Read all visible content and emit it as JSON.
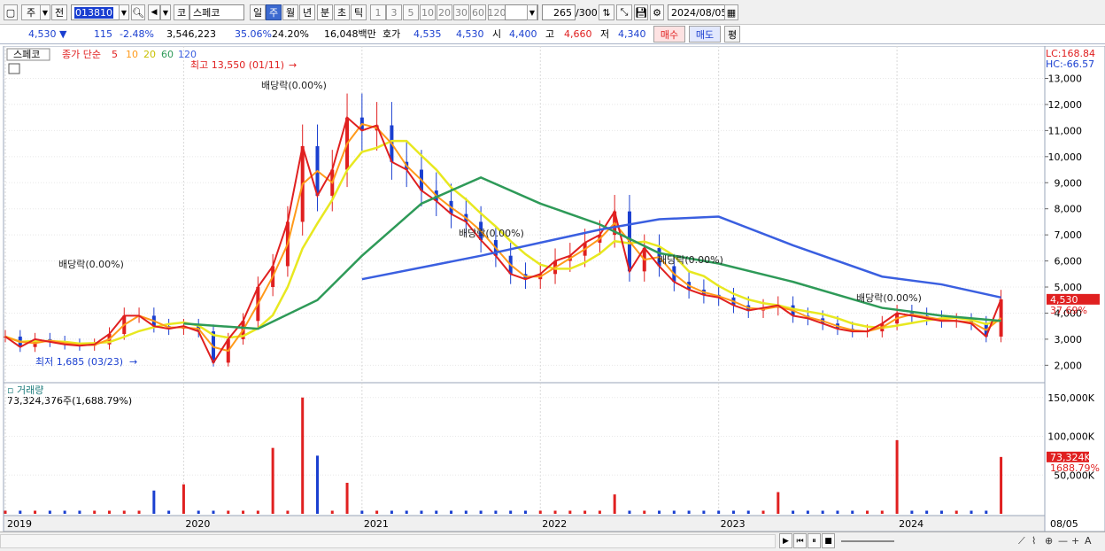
{
  "toolbar": {
    "market": "주",
    "prev_label": "전",
    "code": "013810",
    "market_code": "코",
    "name": "스페코",
    "periods": [
      "일",
      "주",
      "월",
      "년",
      "분",
      "초",
      "틱"
    ],
    "selected_period": "주",
    "intervals": [
      "1",
      "3",
      "5",
      "10",
      "20",
      "30",
      "60",
      "120"
    ],
    "count": "265",
    "count_total": "/300",
    "date": "2024/08/05"
  },
  "quote": {
    "price": "4,530",
    "change": "115",
    "change_pct": "-2.48%",
    "volume": "3,546,223",
    "volume_ratio": "35.06%",
    "turnover": "24.20%",
    "amount": "16,048백만",
    "bid_label": "호가",
    "bid": "4,535",
    "ask": "4,530",
    "open_label": "시",
    "open": "4,400",
    "high_label": "고",
    "high": "4,660",
    "low_label": "저",
    "low": "4,340",
    "buy_label": "매수",
    "sell_label": "매도",
    "eval_label": "평"
  },
  "chart_data": {
    "type": "candlestick",
    "name": "스페코",
    "legend": {
      "price": "종가 단순",
      "ma": [
        {
          "period": "5",
          "color": "#e02020"
        },
        {
          "period": "10",
          "color": "#ff9a1a"
        },
        {
          "period": "20",
          "color": "#e8e820"
        },
        {
          "period": "60",
          "color": "#2e9a58"
        },
        {
          "period": "120",
          "color": "#3a5fe0"
        }
      ]
    },
    "lc_label": "LC:168.84",
    "hc_label": "HC:-66.57",
    "price_axis": [
      "13,000",
      "12,000",
      "11,000",
      "10,000",
      "9,000",
      "8,000",
      "7,000",
      "6,000",
      "5,000",
      "4,000",
      "3,000",
      "2,000"
    ],
    "price_range": [
      1400,
      13900
    ],
    "current_price": "4,530",
    "current_pct": "37.69%",
    "high_annotation": "최고 13,550 (01/11)",
    "low_annotation": "최저 1,685 (03/23)",
    "dividend_label": "배당락(0.00%)",
    "close_series": [
      {
        "date": "2019-01",
        "close": 3100
      },
      {
        "date": "2019-02",
        "close": 2700
      },
      {
        "date": "2019-03",
        "close": 3000
      },
      {
        "date": "2019-04",
        "close": 2900
      },
      {
        "date": "2019-05",
        "close": 2800
      },
      {
        "date": "2019-06",
        "close": 2750
      },
      {
        "date": "2019-07",
        "close": 2800
      },
      {
        "date": "2019-08",
        "close": 3200
      },
      {
        "date": "2019-09",
        "close": 3900
      },
      {
        "date": "2019-10",
        "close": 3900
      },
      {
        "date": "2019-11",
        "close": 3500
      },
      {
        "date": "2019-12",
        "close": 3400
      },
      {
        "date": "2020-01",
        "close": 3500
      },
      {
        "date": "2020-02",
        "close": 3300
      },
      {
        "date": "2020-03",
        "close": 2100
      },
      {
        "date": "2020-04",
        "close": 3000
      },
      {
        "date": "2020-05",
        "close": 3700
      },
      {
        "date": "2020-06",
        "close": 5000
      },
      {
        "date": "2020-07",
        "close": 5800
      },
      {
        "date": "2020-08",
        "close": 7500
      },
      {
        "date": "2020-09",
        "close": 10400
      },
      {
        "date": "2020-10",
        "close": 8500
      },
      {
        "date": "2020-11",
        "close": 9500
      },
      {
        "date": "2020-12",
        "close": 11500
      },
      {
        "date": "2021-01",
        "close": 11000
      },
      {
        "date": "2021-02",
        "close": 11200
      },
      {
        "date": "2021-03",
        "close": 9800
      },
      {
        "date": "2021-04",
        "close": 9500
      },
      {
        "date": "2021-05",
        "close": 8700
      },
      {
        "date": "2021-06",
        "close": 8300
      },
      {
        "date": "2021-07",
        "close": 7800
      },
      {
        "date": "2021-08",
        "close": 7500
      },
      {
        "date": "2021-09",
        "close": 6800
      },
      {
        "date": "2021-10",
        "close": 6200
      },
      {
        "date": "2021-11",
        "close": 5500
      },
      {
        "date": "2021-12",
        "close": 5300
      },
      {
        "date": "2022-01",
        "close": 5500
      },
      {
        "date": "2022-02",
        "close": 6000
      },
      {
        "date": "2022-03",
        "close": 6200
      },
      {
        "date": "2022-04",
        "close": 6700
      },
      {
        "date": "2022-05",
        "close": 7000
      },
      {
        "date": "2022-06",
        "close": 7900
      },
      {
        "date": "2022-07",
        "close": 5600
      },
      {
        "date": "2022-08",
        "close": 6500
      },
      {
        "date": "2022-09",
        "close": 5800
      },
      {
        "date": "2022-10",
        "close": 5200
      },
      {
        "date": "2022-11",
        "close": 4900
      },
      {
        "date": "2022-12",
        "close": 4700
      },
      {
        "date": "2023-01",
        "close": 4600
      },
      {
        "date": "2023-02",
        "close": 4300
      },
      {
        "date": "2023-03",
        "close": 4100
      },
      {
        "date": "2023-04",
        "close": 4200
      },
      {
        "date": "2023-05",
        "close": 4300
      },
      {
        "date": "2023-06",
        "close": 3900
      },
      {
        "date": "2023-07",
        "close": 3800
      },
      {
        "date": "2023-08",
        "close": 3600
      },
      {
        "date": "2023-09",
        "close": 3400
      },
      {
        "date": "2023-10",
        "close": 3300
      },
      {
        "date": "2023-11",
        "close": 3300
      },
      {
        "date": "2023-12",
        "close": 3600
      },
      {
        "date": "2024-01",
        "close": 4000
      },
      {
        "date": "2024-02",
        "close": 3900
      },
      {
        "date": "2024-03",
        "close": 3800
      },
      {
        "date": "2024-04",
        "close": 3700
      },
      {
        "date": "2024-05",
        "close": 3700
      },
      {
        "date": "2024-06",
        "close": 3600
      },
      {
        "date": "2024-07",
        "close": 3100
      },
      {
        "date": "2024-08",
        "close": 4530
      }
    ],
    "ma60_series": [
      {
        "date": "2020-01",
        "value": 3600
      },
      {
        "date": "2020-06",
        "value": 3400
      },
      {
        "date": "2020-10",
        "value": 4500
      },
      {
        "date": "2021-01",
        "value": 6200
      },
      {
        "date": "2021-05",
        "value": 8200
      },
      {
        "date": "2021-09",
        "value": 9200
      },
      {
        "date": "2022-01",
        "value": 8200
      },
      {
        "date": "2022-05",
        "value": 7400
      },
      {
        "date": "2022-09",
        "value": 6300
      },
      {
        "date": "2023-01",
        "value": 5900
      },
      {
        "date": "2023-06",
        "value": 5200
      },
      {
        "date": "2023-12",
        "value": 4200
      },
      {
        "date": "2024-04",
        "value": 3900
      },
      {
        "date": "2024-08",
        "value": 3700
      }
    ],
    "ma120_series": [
      {
        "date": "2021-01",
        "value": 5300
      },
      {
        "date": "2021-09",
        "value": 6200
      },
      {
        "date": "2022-05",
        "value": 7200
      },
      {
        "date": "2022-09",
        "value": 7600
      },
      {
        "date": "2023-01",
        "value": 7700
      },
      {
        "date": "2023-06",
        "value": 6600
      },
      {
        "date": "2023-12",
        "value": 5400
      },
      {
        "date": "2024-04",
        "value": 5100
      },
      {
        "date": "2024-08",
        "value": 4600
      }
    ],
    "volume": {
      "title": "거래량",
      "summary": "73,324,376주(1,688.79%)",
      "axis": [
        "150,000K",
        "100,000K",
        "50,000K"
      ],
      "current_label": "73,324K",
      "current_pct": "1688.79%",
      "range": [
        0,
        160000000
      ],
      "spikes": [
        {
          "date": "2019-11",
          "value": 30000000
        },
        {
          "date": "2020-01",
          "value": 38000000
        },
        {
          "date": "2020-07",
          "value": 85000000
        },
        {
          "date": "2020-09",
          "value": 150000000
        },
        {
          "date": "2020-10",
          "value": 75000000
        },
        {
          "date": "2020-12",
          "value": 40000000
        },
        {
          "date": "2022-06",
          "value": 25000000
        },
        {
          "date": "2023-05",
          "value": 28000000
        },
        {
          "date": "2024-01",
          "value": 95000000
        },
        {
          "date": "2024-08",
          "value": 73324376
        }
      ]
    },
    "x_axis": [
      "2019",
      "2020",
      "2021",
      "2022",
      "2023",
      "2024"
    ],
    "x_end_label": "08/05"
  }
}
